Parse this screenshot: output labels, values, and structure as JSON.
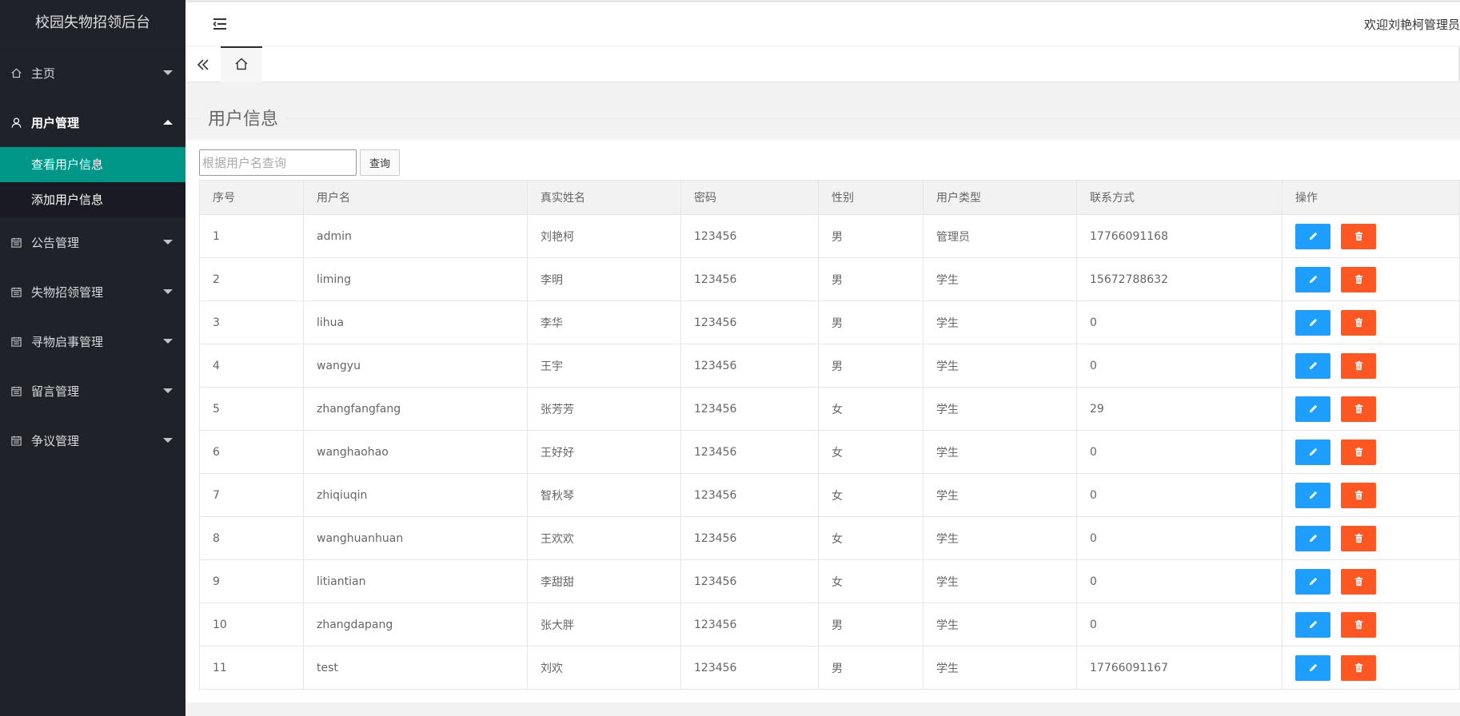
{
  "app": {
    "title": "校园失物招领后台",
    "welcome": "欢迎刘艳柯管理员"
  },
  "sidebar": {
    "items": [
      {
        "label": "主页",
        "icon": "home-icon"
      },
      {
        "label": "用户管理",
        "icon": "user-icon",
        "open": true,
        "children": [
          {
            "label": "查看用户信息",
            "active": true
          },
          {
            "label": "添加用户信息"
          }
        ]
      },
      {
        "label": "公告管理",
        "icon": "calendar-icon"
      },
      {
        "label": "失物招领管理",
        "icon": "calendar-icon"
      },
      {
        "label": "寻物启事管理",
        "icon": "calendar-icon"
      },
      {
        "label": "留言管理",
        "icon": "calendar-icon"
      },
      {
        "label": "争议管理",
        "icon": "calendar-icon"
      }
    ]
  },
  "page": {
    "title": "用户信息"
  },
  "search": {
    "placeholder": "根据用户名查询",
    "button": "查询"
  },
  "table": {
    "headers": [
      "序号",
      "用户名",
      "真实姓名",
      "密码",
      "性别",
      "用户类型",
      "联系方式",
      "操作"
    ],
    "rows": [
      [
        "1",
        "admin",
        "刘艳柯",
        "123456",
        "男",
        "管理员",
        "17766091168"
      ],
      [
        "2",
        "liming",
        "李明",
        "123456",
        "男",
        "学生",
        "15672788632"
      ],
      [
        "3",
        "lihua",
        "李华",
        "123456",
        "男",
        "学生",
        "0"
      ],
      [
        "4",
        "wangyu",
        "王宇",
        "123456",
        "男",
        "学生",
        "0"
      ],
      [
        "5",
        "zhangfangfang",
        "张芳芳",
        "123456",
        "女",
        "学生",
        "29"
      ],
      [
        "6",
        "wanghaohao",
        "王好好",
        "123456",
        "女",
        "学生",
        "0"
      ],
      [
        "7",
        "zhiqiuqin",
        "智秋琴",
        "123456",
        "女",
        "学生",
        "0"
      ],
      [
        "8",
        "wanghuanhuan",
        "王欢欢",
        "123456",
        "女",
        "学生",
        "0"
      ],
      [
        "9",
        "litiantian",
        "李甜甜",
        "123456",
        "女",
        "学生",
        "0"
      ],
      [
        "10",
        "zhangdapang",
        "张大胖",
        "123456",
        "男",
        "学生",
        "0"
      ],
      [
        "11",
        "test",
        "刘欢",
        "123456",
        "男",
        "学生",
        "17766091167"
      ]
    ]
  },
  "colors": {
    "sidebar_bg": "#20222a",
    "active_item": "#009688",
    "edit_button": "#1e9fff",
    "delete_button": "#ff5722"
  }
}
